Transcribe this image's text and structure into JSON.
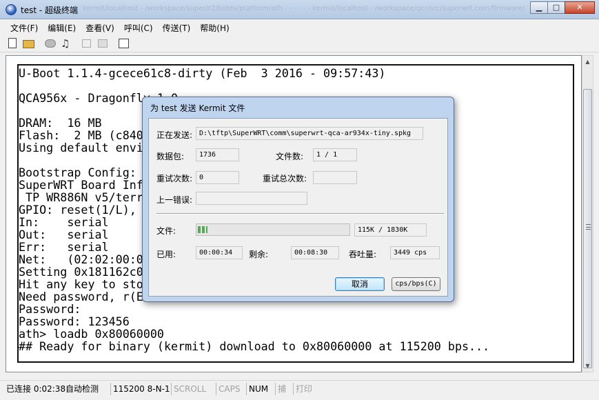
{
  "window": {
    "title": "test - 超级终端",
    "blurred_path": "kermit/localhost - /workspace/super/r2/b/dev/platform/ath - - - - - - kermit/localhost - /workspace/qcr/src/superwrt.com/firmware/",
    "buttons": {
      "minimize": "▁",
      "maximize": "□",
      "close": "✕"
    }
  },
  "menu": {
    "items": [
      "文件(F)",
      "编辑(E)",
      "查看(V)",
      "呼叫(C)",
      "传送(T)",
      "帮助(H)"
    ]
  },
  "toolbar": {
    "props_glyph": "♫"
  },
  "terminal": {
    "lines": [
      "U-Boot 1.1.4-gcece61c8-dirty (Feb  3 2016 - 09:57:43)",
      "",
      "QCA956x - Dragonfly 1.0",
      "",
      "DRAM:  16 MB",
      "Flash:  2 MB (c8401",
      "Using default envir",
      "",
      "Bootstrap Config: 0",
      "SuperWRT Board Info",
      " TP WR886N v5/terra",
      "GPIO: reset(1/L), s",
      "In:    serial",
      "Out:   serial",
      "Err:   serial",
      "Net:   (02:02:00:02",
      "Setting 0x181162c0",
      "Hit any key to stop",
      "Need password, r(En",
      "Password:",
      "Password: 123456",
      "ath> loadb 0x80060000",
      "## Ready for binary (kermit) download to 0x80060000 at 115200 bps..."
    ]
  },
  "dialog": {
    "title": "为 test 发送 Kermit 文件",
    "sending_label": "正在发送:",
    "sending_value": "D:\\tftp\\SuperWRT\\comm\\superwrt-qca-ar934x-tiny.spkg",
    "packets_label": "数据包:",
    "packets_value": "1736",
    "files_label": "文件数:",
    "files_value": "1 / 1",
    "retries_label": "重试次数:",
    "retries_value": "0",
    "total_retries_label": "重试总次数:",
    "total_retries_value": "",
    "last_error_label": "上一错误:",
    "last_error_value": "",
    "file_label": "文件:",
    "file_size_value": "115K / 1830K",
    "file_progress": 0.063,
    "elapsed_label": "已用:",
    "elapsed_value": "00:00:34",
    "remaining_label": "剩余:",
    "remaining_value": "00:08:30",
    "throughput_label": "吞吐量:",
    "throughput_value": "3449 cps",
    "cancel_label": "取消",
    "cps_label": "cps/bps(C)"
  },
  "statusbar": {
    "connected": "已连接 0:02:38",
    "detect": "自动检测",
    "settings": "115200 8-N-1",
    "scroll": "SCROLL",
    "caps": "CAPS",
    "num": "NUM",
    "capture": "捕",
    "print": "打印"
  }
}
